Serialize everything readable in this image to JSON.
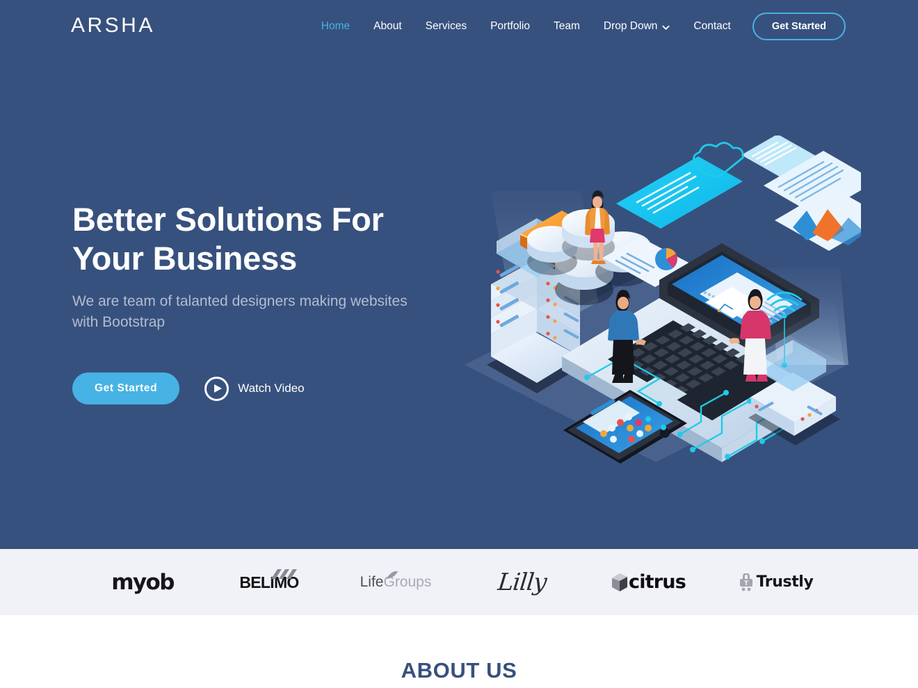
{
  "site": {
    "logo_text": "ARSHA",
    "accent_color": "#47b2e4",
    "hero_bg_color": "#37517e",
    "clients_bg_color": "#f1f2f8"
  },
  "nav": {
    "items": [
      {
        "label": "Home",
        "active": true
      },
      {
        "label": "About",
        "active": false
      },
      {
        "label": "Services",
        "active": false
      },
      {
        "label": "Portfolio",
        "active": false
      },
      {
        "label": "Team",
        "active": false
      },
      {
        "label": "Drop Down",
        "active": false,
        "has_dropdown": true
      },
      {
        "label": "Contact",
        "active": false
      }
    ],
    "cta_label": "Get Started"
  },
  "hero": {
    "title_line1": "Better Solutions For",
    "title_line2": "Your Business",
    "subtitle": "We are team of talanted designers making websites with Bootstrap",
    "primary_button": "Get Started",
    "video_button": "Watch Video",
    "illustration_name": "isometric-business-tech-illustration"
  },
  "clients": [
    {
      "name": "myob",
      "label": "myob"
    },
    {
      "name": "belimo",
      "label": "BELIMO"
    },
    {
      "name": "lifegroups",
      "label_dark": "Life",
      "label_light": "Groups"
    },
    {
      "name": "lilly",
      "label": "Lilly"
    },
    {
      "name": "citrus",
      "label": "citrus"
    },
    {
      "name": "trustly",
      "label": "Trustly"
    }
  ],
  "about": {
    "heading": "ABOUT US"
  }
}
